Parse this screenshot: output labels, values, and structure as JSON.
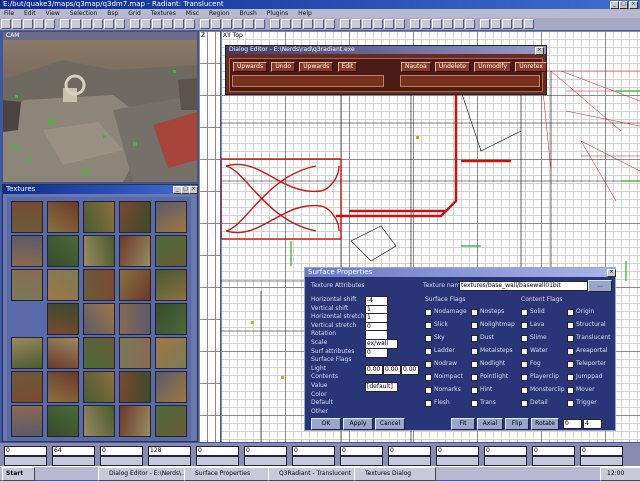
{
  "app": {
    "title": "E:/but/quake3/maps/q3map/q3dm7.map - Radiant: Translucent",
    "menu": [
      "File",
      "Edit",
      "View",
      "Selection",
      "Bsp",
      "Grid",
      "Textures",
      "Misc",
      "Region",
      "Brush",
      "Plugins",
      "Help"
    ]
  },
  "panels": {
    "cam_title": "CAM",
    "textures_title": "Textures",
    "xy_title": "XY Top",
    "z_label": "Z"
  },
  "dialog_editor": {
    "title": "Dialog Editor - E:\\Nerds\\rad\\q3radiant.exe",
    "buttons": [
      "Upwards",
      "Undo",
      "Upwards",
      "Edit",
      "Nautoa",
      "Undelete",
      "Unmodify",
      "Unretex"
    ]
  },
  "surface": {
    "title": "Surface Properties",
    "texture_attr": "Texture Attributes",
    "field_labels": [
      "Horizontal shift",
      "Vertical shift",
      "Horizontal stretch",
      "Vertical stretch",
      "Rotation",
      "Scale",
      "Surf attributes",
      "Surface Flags",
      "Light",
      "Contents",
      "Value",
      "Color",
      "Default",
      "Other"
    ],
    "values": [
      "-4",
      "1",
      "1",
      "0",
      "",
      "ex/wall",
      "0",
      "0.00",
      "0.00",
      "0.00",
      "[default]"
    ],
    "shader_label": "Texture name",
    "shader_value": "textures/base_wall/basewall01bit",
    "surface_flags_label": "Surface Flags",
    "content_flags_label": "Content Flags",
    "surface_flags": [
      "Nodamage",
      "Slick",
      "Sky",
      "Ladder",
      "Nodraw",
      "Noimpact",
      "Nomarks",
      "Flesh",
      "Nosteps",
      "Nolightmap",
      "Dust",
      "Metalsteps",
      "Nodlight",
      "Pointlight",
      "Hint",
      "Trans"
    ],
    "content_flags": [
      "Solid",
      "Lava",
      "Slime",
      "Water",
      "Fog",
      "Playerclip",
      "Monsterclip",
      "Detail",
      "Origin",
      "Structural",
      "Translucent",
      "Areaportal",
      "Teleporter",
      "Jumppad",
      "Mover",
      "Trigger"
    ],
    "buttons": [
      "OK",
      "Apply",
      "Cancel",
      "Fit",
      "Axial",
      "Flip",
      "Rotate"
    ],
    "bottom_values": [
      "0",
      "4"
    ]
  },
  "status": {
    "fields": [
      "0",
      "64",
      "0",
      "128",
      "0",
      "0",
      "0",
      "0",
      "0",
      "0",
      "0",
      "0",
      "0"
    ]
  },
  "taskbar": {
    "start": "Start",
    "items": [
      "Dialog Editor - E:\\Nerds\\...",
      "Surface Properties",
      "Q3Radiant - Translucent",
      "Textures Dialog"
    ],
    "clock": "12:00"
  },
  "colors": {
    "desktop": "#3a5aa8",
    "title_active": "#0c2a8e",
    "brush": "#d01010",
    "dialog": "#2a3578"
  }
}
